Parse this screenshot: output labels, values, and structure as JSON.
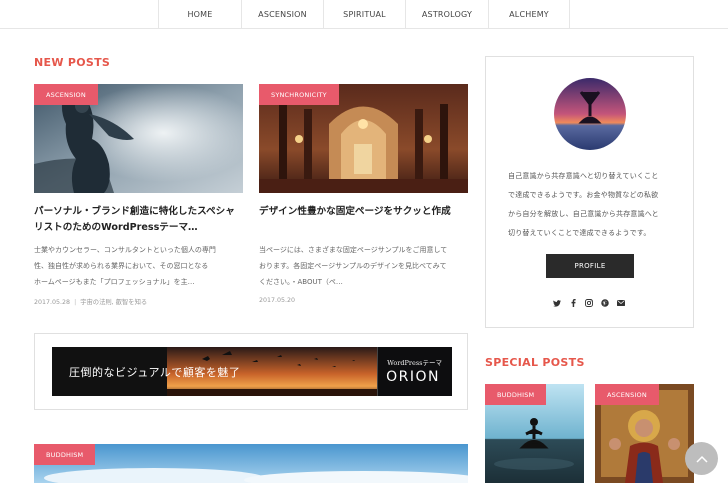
{
  "nav": {
    "items": [
      "HOME",
      "ASCENSION",
      "SPIRITUAL",
      "ASTROLOGY",
      "ALCHEMY"
    ]
  },
  "new_posts": {
    "title": "NEW POSTS",
    "posts": [
      {
        "category": "ASCENSION",
        "title_line1": "パーソナル・ブランド創造に特化したスペシャ",
        "title_line2": "リストのためのWordPressテーマ…",
        "excerpt_line1": "士業やカウンセラー、コンサルタントといった個人の専門",
        "excerpt_line2": "性、独自性が求められる業界において、その窓口となる",
        "excerpt_line3": "ホームページもまた「プロフェッショナル」を主…",
        "date": "2017.05.28",
        "tags": "宇宙の法則, 叡智を知る"
      },
      {
        "category": "SYNCHRONICITY",
        "title_line1": "デザイン性豊かな固定ページをサクッと作成",
        "excerpt_line1": "当ページには、さまざまな固定ページサンプルをご用意して",
        "excerpt_line2": "おります。各固定ページサンプルのデザインを見比べてみて",
        "excerpt_line3": "ください。・ABOUT（ペ…",
        "date": "2017.05.20"
      }
    ]
  },
  "banner": {
    "text": "圧倒的なビジュアルで顧客を魅了",
    "brand_small": "WordPressテーマ",
    "brand": "ORION"
  },
  "third_post": {
    "category": "BUDDHISM"
  },
  "profile": {
    "text_line1": "自己意識から共存意識へと切り替えていくこと",
    "text_line2": "で達成できるようです。お金や物質などの私欲",
    "text_line3": "から自分を解放し、自己意識から共存意識へと",
    "text_line4": "切り替えていくことで達成できるようです。",
    "button": "PROFILE",
    "social_icons": [
      "twitter-icon",
      "facebook-icon",
      "instagram-icon",
      "pinterest-icon",
      "mail-icon"
    ]
  },
  "special_posts": {
    "title": "SPECIAL POSTS",
    "posts": [
      {
        "category": "BUDDHISM"
      },
      {
        "category": "ASCENSION"
      }
    ]
  },
  "colors": {
    "accent": "#e6574b",
    "badge": "#e85a6b",
    "button": "#2a2a2a"
  }
}
